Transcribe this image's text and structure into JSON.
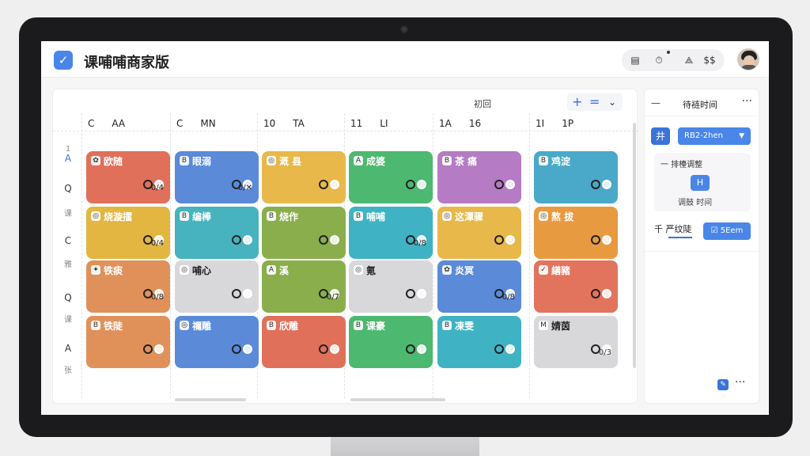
{
  "app": {
    "title": "课哺哺商家版",
    "logo_icon": "check-icon"
  },
  "header": {
    "actions": [
      "layout-icon",
      "timer-icon",
      "sync-icon",
      "$$"
    ]
  },
  "calendar": {
    "center_label": "初回",
    "tools": [
      "+",
      "=",
      "⌄"
    ],
    "columns": [
      {
        "a": "C",
        "b": "AA"
      },
      {
        "a": "C",
        "b": "MN"
      },
      {
        "a": "10",
        "b": "TA"
      },
      {
        "a": "11",
        "b": "LI"
      },
      {
        "a": "1A",
        "b": "16"
      },
      {
        "a": "1I",
        "b": "1P"
      }
    ],
    "rows": [
      {
        "label": "A",
        "sub": "1"
      },
      {
        "label": "Q",
        "sub": "课"
      },
      {
        "label": "C",
        "sub": "雅"
      },
      {
        "label": "Q",
        "sub": "课"
      },
      {
        "label": "A",
        "sub": "张"
      }
    ],
    "cards": [
      [
        {
          "title": "欧随",
          "meta": "0/4",
          "color": "#e0705a",
          "icon": "✿"
        },
        {
          "title": "眼溺",
          "meta": "0/✕",
          "color": "#5b8ad9",
          "icon": "B"
        },
        {
          "title": "溉 县",
          "meta": "",
          "color": "#e8b94a",
          "icon": "◎"
        },
        {
          "title": "成婆",
          "meta": "",
          "color": "#4db870",
          "icon": "A"
        },
        {
          "title": "茶 痛",
          "meta": "",
          "color": "#b57bc4",
          "icon": "B"
        },
        {
          "title": "鸡淀",
          "meta": "",
          "color": "#4aa9c8",
          "icon": "B"
        }
      ],
      [
        {
          "title": "烧漩擂",
          "meta": "0/4",
          "color": "#e2b640",
          "icon": "◎"
        },
        {
          "title": "编棒",
          "meta": "",
          "color": "#46b3be",
          "icon": "B"
        },
        {
          "title": "烧作",
          "meta": "",
          "color": "#8aae4c",
          "icon": "B"
        },
        {
          "title": "哺哺",
          "meta": "0/8",
          "color": "#3fb3c4",
          "icon": "B"
        },
        {
          "title": "这潭骤",
          "meta": "",
          "color": "#e8b94a",
          "icon": "◎"
        },
        {
          "title": "熬 拔",
          "meta": "",
          "color": "#e89a40",
          "icon": "◎"
        }
      ],
      [
        {
          "title": "铁痰",
          "meta": "0/8",
          "color": "#e0915a",
          "icon": "✦"
        },
        {
          "title": "哺心",
          "meta": "",
          "color": "#d8d8da",
          "icon": "◎",
          "dark": true
        },
        {
          "title": "溪",
          "meta": "0/7",
          "color": "#8aae4c",
          "icon": "A"
        },
        {
          "title": "氪",
          "meta": "",
          "color": "#d8d8da",
          "icon": "◎",
          "dark": true
        },
        {
          "title": "炎冥",
          "meta": "0/8",
          "color": "#5b8ad9",
          "icon": "✿"
        },
        {
          "title": "繕豬",
          "meta": "",
          "color": "#e2745e",
          "icon": "✓"
        }
      ],
      [
        {
          "title": "铁陡",
          "meta": "",
          "color": "#e0915a",
          "icon": "B"
        },
        {
          "title": "禰雕",
          "meta": "",
          "color": "#5b8ad9",
          "icon": "◎"
        },
        {
          "title": "欣雕",
          "meta": "",
          "color": "#e0705a",
          "icon": "B"
        },
        {
          "title": "课豪",
          "meta": "",
          "color": "#4db870",
          "icon": "B"
        },
        {
          "title": "凍雯",
          "meta": "",
          "color": "#3fb3c4",
          "icon": "B"
        },
        {
          "title": "婧茵",
          "meta": "0/3",
          "color": "#d8d8da",
          "icon": "M",
          "dark": true
        }
      ]
    ]
  },
  "side": {
    "dash": "—",
    "title": "待裢时间",
    "more": "···",
    "filter_icon": "井",
    "select_value": "RB2-2hen",
    "adjust_label": "一 排檯调整",
    "adjust_button": "H",
    "adjust_sub": "调鼓 时间",
    "row_label": "千 严纹陡",
    "pill_label": "☑ 5Eem",
    "fab_icon": "✎",
    "fab_more": "···"
  }
}
